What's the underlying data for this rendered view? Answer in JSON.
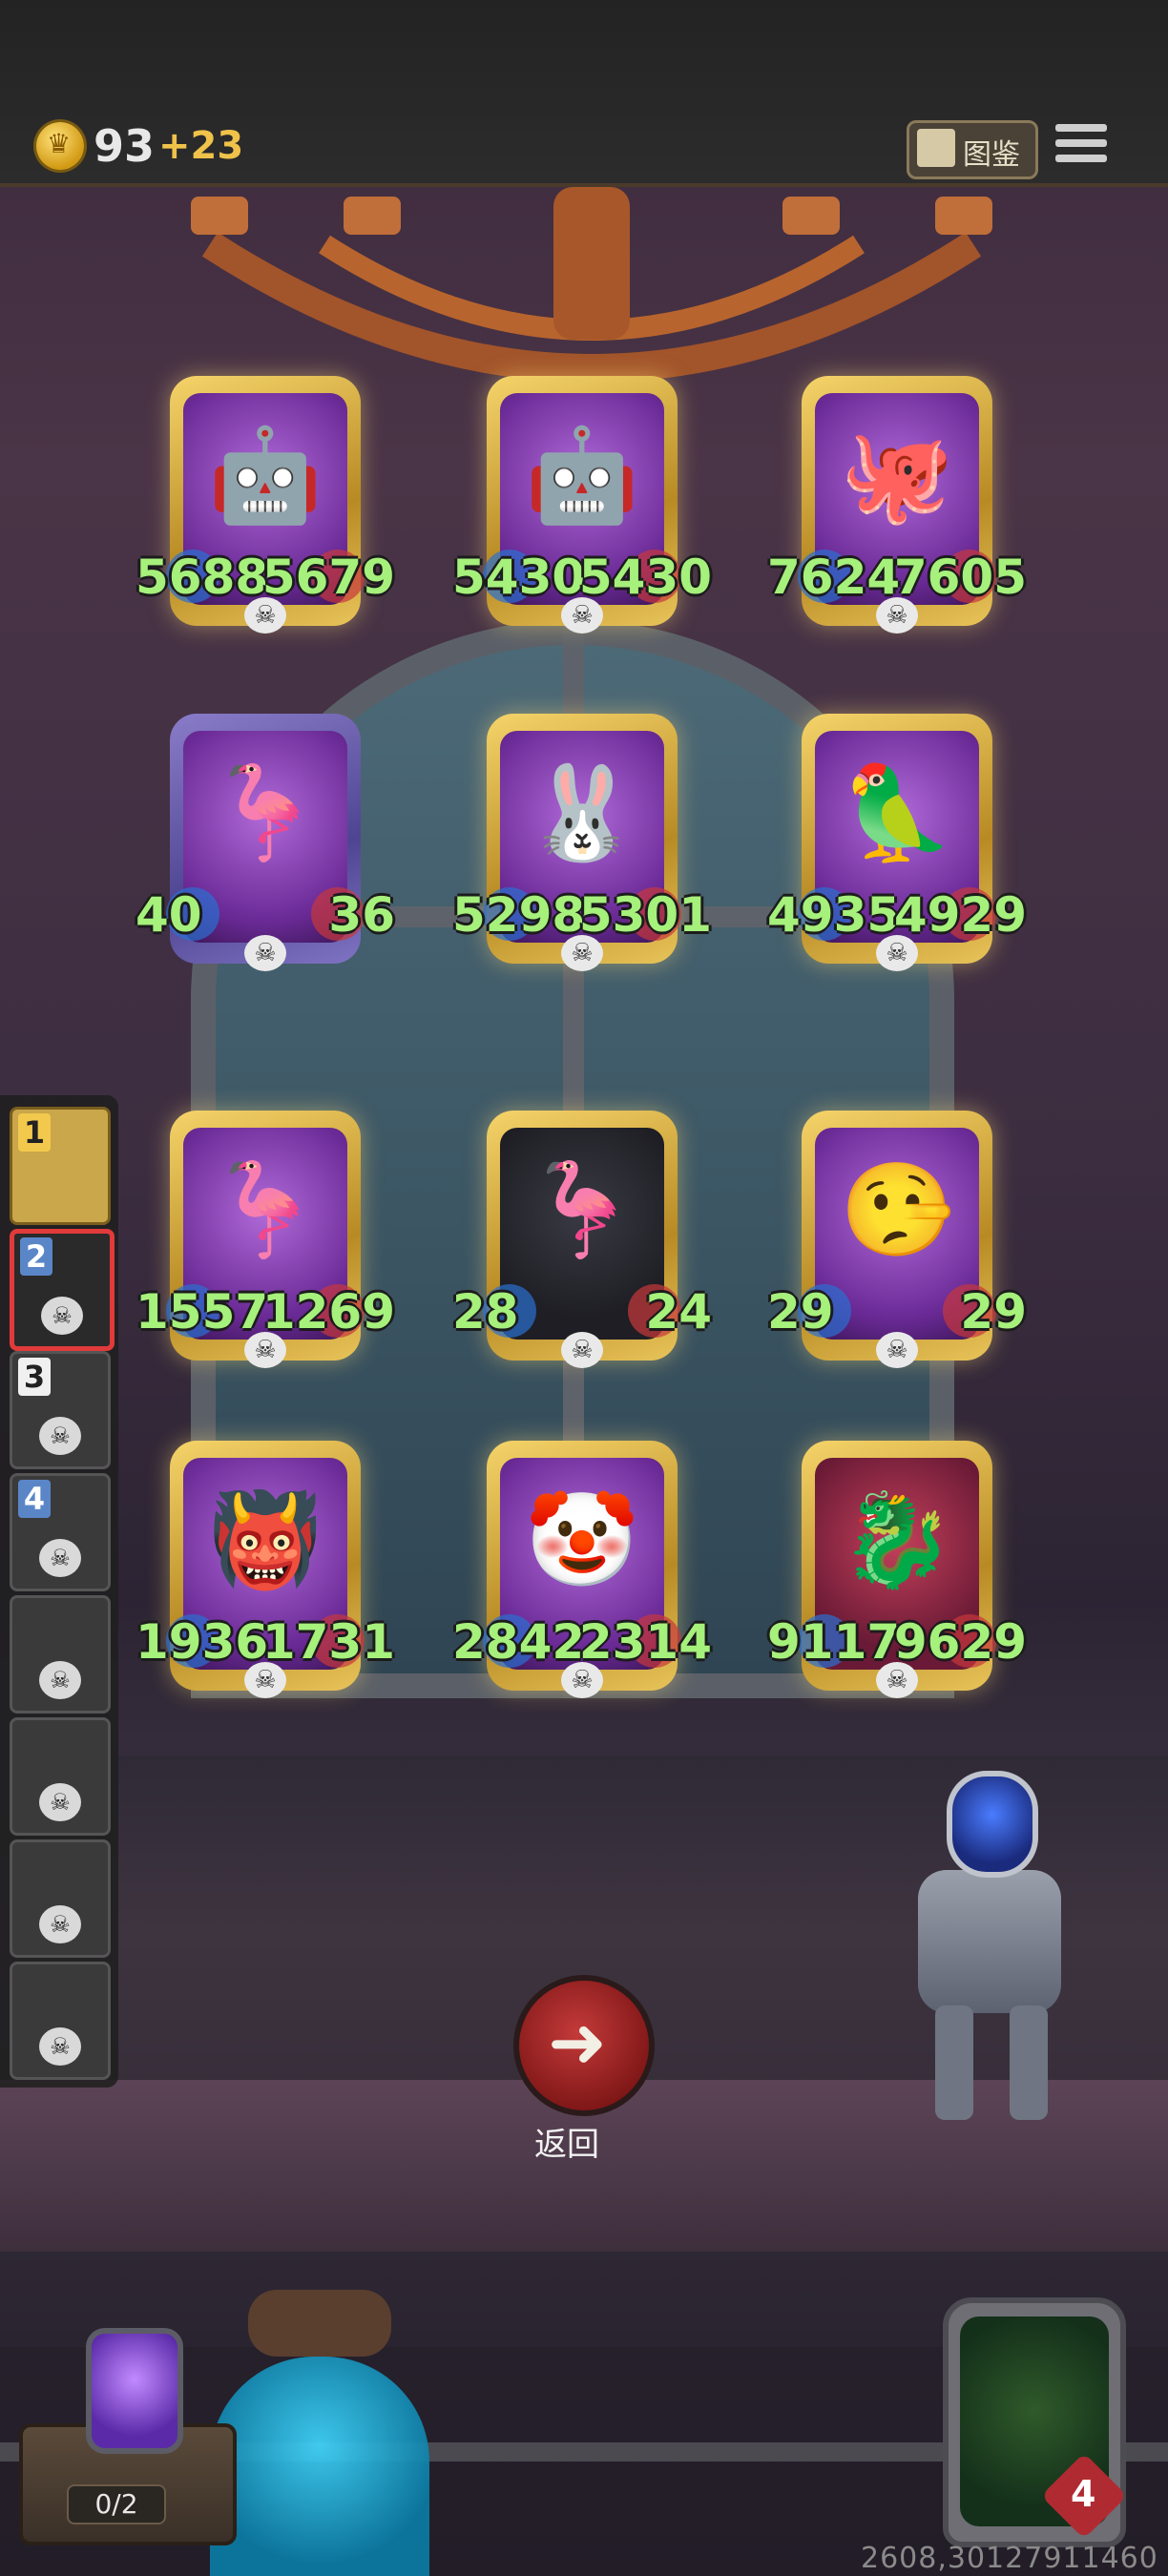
{
  "top_bar": {
    "gold": "93",
    "gold_bonus": "+23",
    "codex_label": "图鉴",
    "icons": {
      "coin": "crown-coin-icon",
      "codex": "codex-book-icon",
      "menu": "hamburger-menu-icon"
    }
  },
  "board": {
    "rows": [
      [
        {
          "name": "golden-robot-card",
          "attack": "5688",
          "health": "5679",
          "art": "🤖",
          "frame": "gold",
          "bg": "purple"
        },
        {
          "name": "golden-robot-card",
          "attack": "5430",
          "health": "5430",
          "art": "🤖",
          "frame": "gold",
          "bg": "purple"
        },
        {
          "name": "octopus-pirate-card",
          "attack": "7624",
          "health": "7605",
          "art": "🐙",
          "frame": "gold",
          "bg": "purple"
        }
      ],
      [
        {
          "name": "pelican-card",
          "attack": "40",
          "health": "36",
          "art": "🦩",
          "frame": "purple",
          "bg": "purple"
        },
        {
          "name": "masked-rabbit-card",
          "attack": "5298",
          "health": "5301",
          "art": "🐰",
          "frame": "gold",
          "bg": "purple"
        },
        {
          "name": "parrot-card",
          "attack": "4935",
          "health": "4929",
          "art": "🦜",
          "frame": "gold",
          "bg": "purple"
        }
      ],
      [
        {
          "name": "pelican-card",
          "attack": "1557",
          "health": "1269",
          "art": "🦩",
          "frame": "gold",
          "bg": "purple"
        },
        {
          "name": "pelican-card",
          "attack": "28",
          "health": "24",
          "art": "🦩",
          "frame": "gold",
          "bg": "dark"
        },
        {
          "name": "puppet-card",
          "attack": "29",
          "health": "29",
          "art": "🤥",
          "frame": "gold",
          "bg": "purple"
        }
      ],
      [
        {
          "name": "horned-beast-card",
          "attack": "1936",
          "health": "1731",
          "art": "👹",
          "frame": "gold",
          "bg": "purple"
        },
        {
          "name": "clown-card",
          "attack": "2842",
          "health": "2314",
          "art": "🤡",
          "frame": "gold",
          "bg": "purple"
        },
        {
          "name": "red-dragon-card",
          "attack": "9117",
          "health": "9629",
          "art": "🐉",
          "frame": "gold",
          "bg": "red"
        }
      ]
    ],
    "skull_icon": "skull-icon"
  },
  "roster": {
    "slots": [
      {
        "num": "1",
        "style": "gold"
      },
      {
        "num": "2",
        "style": "selected"
      },
      {
        "num": "3",
        "style": "plain"
      },
      {
        "num": "4",
        "style": "blue"
      },
      {
        "num": "",
        "style": "plain"
      },
      {
        "num": "",
        "style": "plain"
      },
      {
        "num": "",
        "style": "plain"
      },
      {
        "num": "",
        "style": "plain"
      }
    ]
  },
  "controls": {
    "back_label": "返回",
    "back_icon": "arrow-left-icon"
  },
  "bottom": {
    "chest_count": "0/2",
    "lives": "4",
    "coords": "2608,30127911460"
  }
}
